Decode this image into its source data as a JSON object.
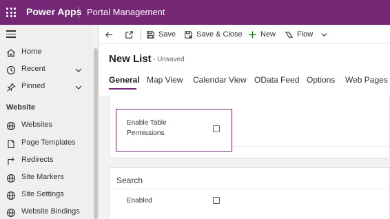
{
  "topbar": {
    "app_name": "Power Apps",
    "portal_name": "Portal Management",
    "color": "#742774"
  },
  "sidebar": {
    "menu_icon": "hamburger-icon",
    "items_top": [
      {
        "label": "Home",
        "icon": "home-icon"
      },
      {
        "label": "Recent",
        "icon": "clock-icon",
        "expandable": true
      },
      {
        "label": "Pinned",
        "icon": "pin-icon",
        "expandable": true
      }
    ],
    "section_label": "Website",
    "items": [
      {
        "label": "Websites",
        "icon": "globe-icon"
      },
      {
        "label": "Page Templates",
        "icon": "page-icon"
      },
      {
        "label": "Redirects",
        "icon": "redirect-icon"
      },
      {
        "label": "Site Markers",
        "icon": "globe-icon"
      },
      {
        "label": "Site Settings",
        "icon": "globe-icon"
      },
      {
        "label": "Website Bindings",
        "icon": "globe-icon"
      }
    ]
  },
  "commandbar": {
    "back_icon": "back-arrow-icon",
    "popout_icon": "open-in-new-window-icon",
    "save": "Save",
    "save_close": "Save & Close",
    "new": "New",
    "flow": "Flow"
  },
  "form": {
    "title": "New List",
    "status": "- Unsaved",
    "tabs": [
      {
        "label": "General",
        "active": true
      },
      {
        "label": "Map View"
      },
      {
        "label": "Calendar View"
      },
      {
        "label": "OData Feed"
      },
      {
        "label": "Options"
      },
      {
        "label": "Web Pages"
      }
    ]
  },
  "fields": {
    "enable_table_permissions": {
      "label_line1": "Enable Table",
      "label_line2": "Permissions",
      "checked": false
    },
    "search_section": {
      "title": "Search",
      "enabled_label": "Enabled",
      "enabled_checked": false
    }
  }
}
